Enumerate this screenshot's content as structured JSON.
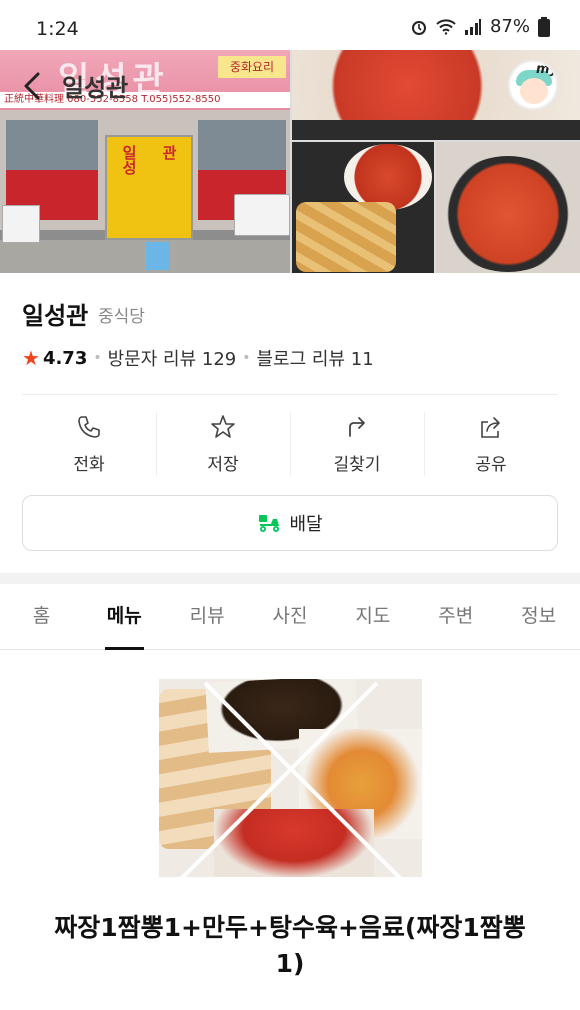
{
  "status_bar": {
    "time": "1:24",
    "battery": "87%"
  },
  "header": {
    "title": "일성관",
    "avatar_badge": "my"
  },
  "hero": {
    "sign_big": "일성관",
    "sign_tag": "중화요리",
    "sign_strip": "正統中華料理   080-552-8558      T.055)552-8550",
    "door_left": "일성",
    "door_right": "관"
  },
  "place": {
    "name": "일성관",
    "category": "중식당",
    "rating": "4.73",
    "visitor_reviews": "방문자 리뷰 129",
    "blog_reviews": "블로그 리뷰 11"
  },
  "actions": [
    {
      "label": "전화",
      "icon": "phone-icon"
    },
    {
      "label": "저장",
      "icon": "star-icon"
    },
    {
      "label": "길찾기",
      "icon": "directions-icon"
    },
    {
      "label": "공유",
      "icon": "share-icon"
    }
  ],
  "delivery": {
    "label": "배달",
    "icon": "delivery-scooter-icon",
    "icon_color": "#03c75a"
  },
  "tabs": [
    {
      "label": "홈",
      "active": false
    },
    {
      "label": "메뉴",
      "active": true
    },
    {
      "label": "리뷰",
      "active": false
    },
    {
      "label": "사진",
      "active": false
    },
    {
      "label": "지도",
      "active": false
    },
    {
      "label": "주변",
      "active": false
    },
    {
      "label": "정보",
      "active": false
    }
  ],
  "menu": {
    "item_name": "짜장1짬뽕1+만두+탕수육+음료(짜장1짬뽕1)"
  },
  "colors": {
    "rating_star": "#f0421c",
    "accent_green": "#03c75a"
  }
}
